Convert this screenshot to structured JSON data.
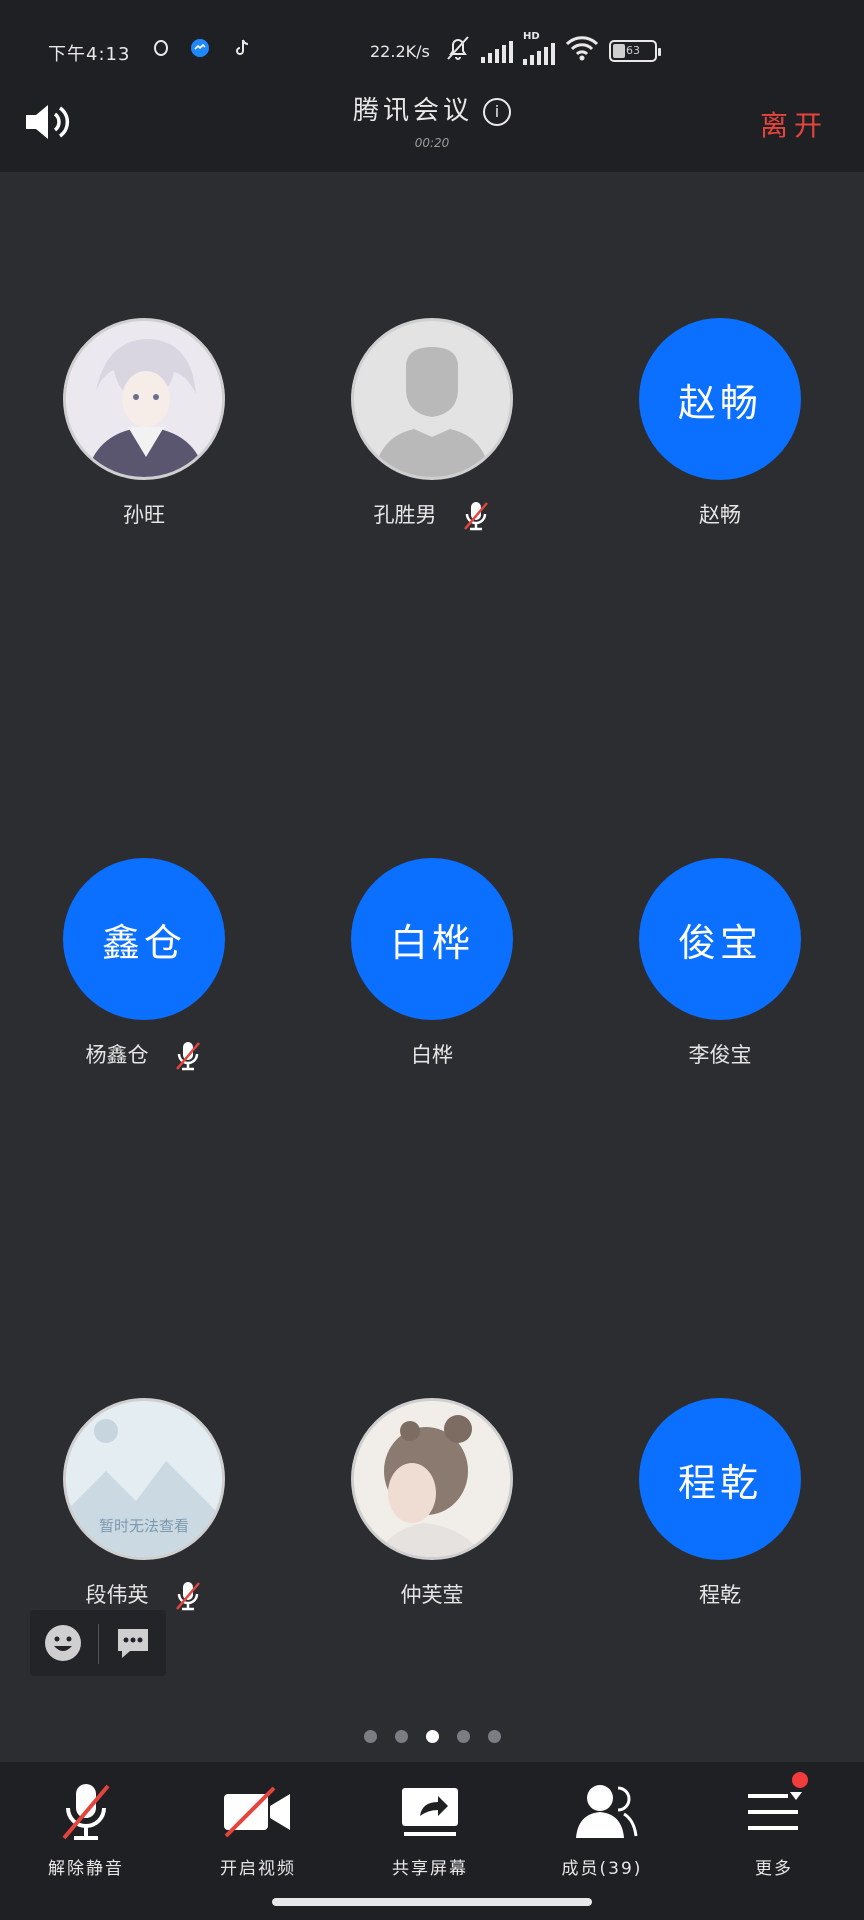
{
  "status_bar": {
    "time": "下午4:13",
    "net_speed": "22.2K/s",
    "network_label": "HD",
    "battery_level": "63"
  },
  "header": {
    "title": "腾讯会议",
    "timer": "00:20",
    "leave_label": "离开",
    "accent_leave": "#e5443d"
  },
  "participants": [
    {
      "name": "孙旺",
      "avatar_text": "",
      "avatar_kind": "photo-anime",
      "muted": false
    },
    {
      "name": "孔胜男",
      "avatar_text": "",
      "avatar_kind": "placeholder",
      "muted": true
    },
    {
      "name": "赵畅",
      "avatar_text": "赵畅",
      "avatar_kind": "blue",
      "muted": false
    },
    {
      "name": "杨鑫仓",
      "avatar_text": "鑫仓",
      "avatar_kind": "blue",
      "muted": true
    },
    {
      "name": "白桦",
      "avatar_text": "白桦",
      "avatar_kind": "blue",
      "muted": false
    },
    {
      "name": "李俊宝",
      "avatar_text": "俊宝",
      "avatar_kind": "blue",
      "muted": false
    },
    {
      "name": "段伟英",
      "avatar_text": "暂时无法查看",
      "avatar_kind": "unavailable",
      "muted": true
    },
    {
      "name": "仲芙莹",
      "avatar_text": "",
      "avatar_kind": "photo-girl",
      "muted": false
    },
    {
      "name": "程乾",
      "avatar_text": "程乾",
      "avatar_kind": "blue",
      "muted": false
    }
  ],
  "pager": {
    "total": 5,
    "active_index": 2
  },
  "toolbar": {
    "unmute_label": "解除静音",
    "video_label": "开启视频",
    "share_label": "共享屏幕",
    "members_label": "成员(39)",
    "more_label": "更多"
  },
  "colors": {
    "background": "#2b2d31",
    "bar": "#1f2023",
    "avatar_blue": "#0b6fff",
    "badge_red": "#f23c3c"
  }
}
